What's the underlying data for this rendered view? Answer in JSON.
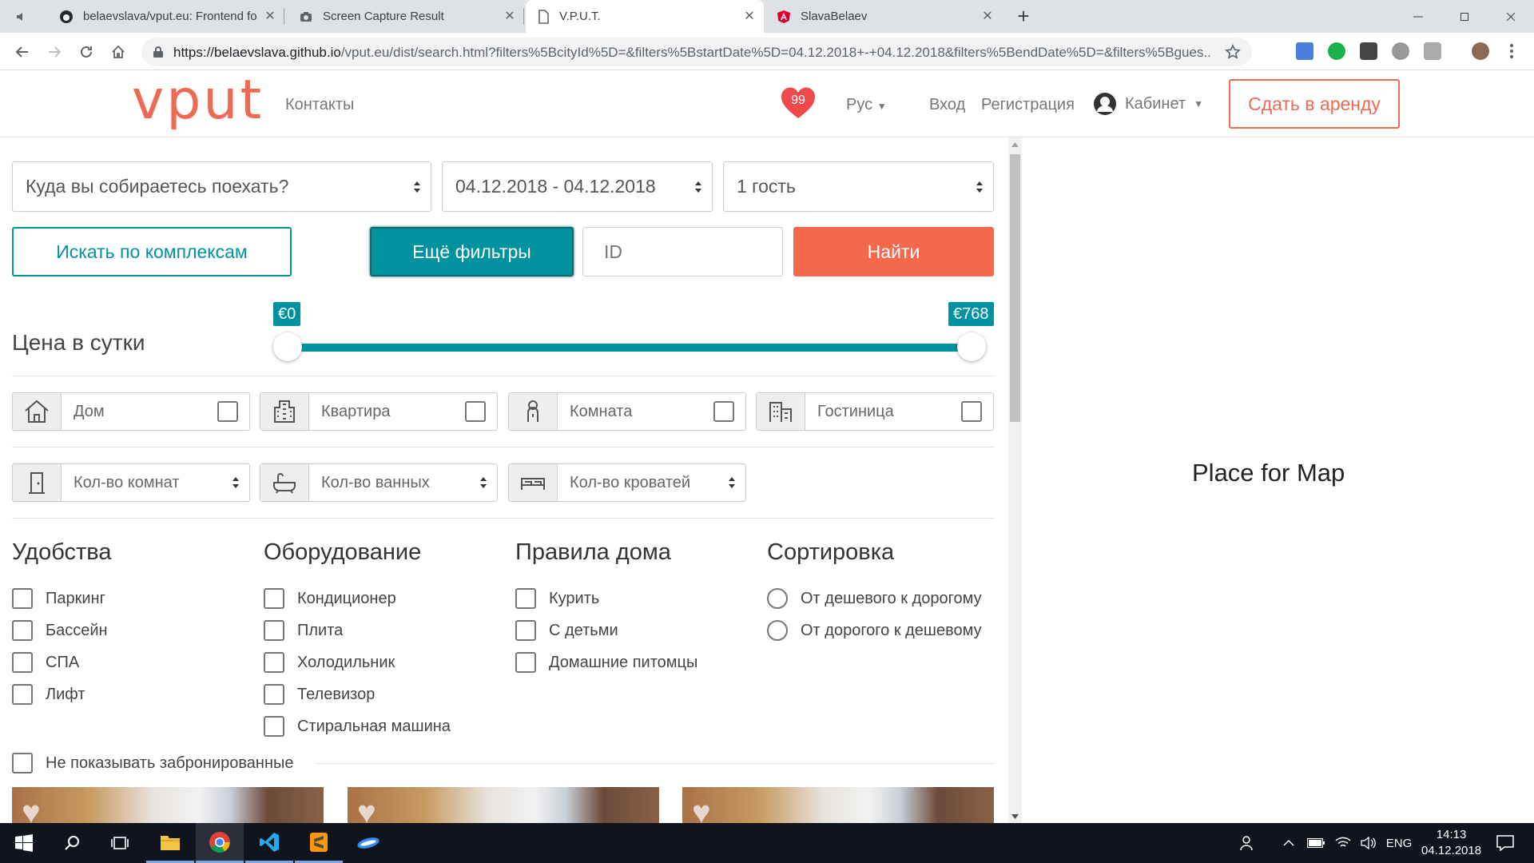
{
  "browser": {
    "tabs": [
      {
        "title": "belaevslava/vput.eu: Frontend fo",
        "icon": "github-icon"
      },
      {
        "title": "Screen Capture Result",
        "icon": "camera-icon"
      },
      {
        "title": "V.P.U.T.",
        "icon": "page-icon"
      },
      {
        "title": "SlavaBelaev",
        "icon": "angular-icon"
      }
    ],
    "url_host": "https://belaevslava.github.io",
    "url_rest": "/vput.eu/dist/search.html?filters%5BcityId%5D=&filters%5BstartDate%5D=04.12.2018+-+04.12.2018&filters%5BendDate%5D=&filters%5Bgues..."
  },
  "header": {
    "logo": "vput",
    "contacts": "Контакты",
    "favorites_count": "99",
    "language": "Рус",
    "login": "Вход",
    "register": "Регистрация",
    "cabinet": "Кабинет",
    "rent_button": "Сдать в аренду"
  },
  "search": {
    "destination": "Куда вы собираетесь поехать?",
    "dates": "04.12.2018 - 04.12.2018",
    "guests": "1 гость",
    "complex_button": "Искать по комплексам",
    "more_filters_button": "Ещё фильтры",
    "id_placeholder": "ID",
    "find_button": "Найти"
  },
  "price": {
    "label": "Цена в сутки",
    "min": "€0",
    "max": "€768",
    "range_low_fraction": 0.0,
    "range_high_fraction": 1.0
  },
  "property_types": [
    "Дом",
    "Квартира",
    "Комната",
    "Гостиница"
  ],
  "counts": [
    "Кол-во комнат",
    "Кол-во ванных",
    "Кол-во кроватей"
  ],
  "amenities": {
    "title": "Удобства",
    "items": [
      "Паркинг",
      "Бассейн",
      "СПА",
      "Лифт"
    ]
  },
  "equipment": {
    "title": "Оборудование",
    "items": [
      "Кондиционер",
      "Плита",
      "Холодильник",
      "Телевизор",
      "Стиральная машина"
    ]
  },
  "rules": {
    "title": "Правила дома",
    "items": [
      "Курить",
      "С детьми",
      "Домашние питомцы"
    ]
  },
  "sorting": {
    "title": "Сортировка",
    "items": [
      "От дешевого к дорогому",
      "От дорогого к дешевому"
    ]
  },
  "hide_booked": "Не показывать забронированные",
  "map_placeholder": "Place for Map",
  "taskbar": {
    "language": "ENG",
    "time": "14:13",
    "date": "04.12.2018"
  },
  "colors": {
    "accent": "#00939f",
    "brand": "#ef6a55",
    "find": "#f4694c"
  }
}
